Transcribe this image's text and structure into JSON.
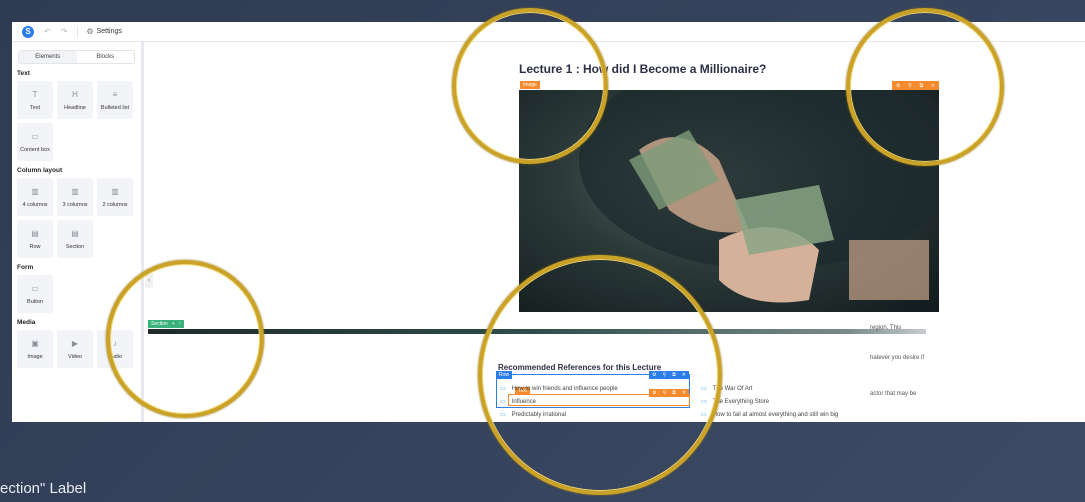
{
  "topbar": {
    "logo_letter": "S",
    "undo": "↶",
    "redo": "↷",
    "settings_label": "Settings"
  },
  "sidebar": {
    "tabs": [
      "Elements",
      "Blocks"
    ],
    "sections": [
      {
        "title": "Text",
        "items": [
          {
            "label": "Text",
            "icon": "T"
          },
          {
            "label": "Headline",
            "icon": "H"
          },
          {
            "label": "Bulleted list",
            "icon": "≡"
          },
          {
            "label": "Content box",
            "icon": "▭"
          }
        ]
      },
      {
        "title": "Column layout",
        "items": [
          {
            "label": "4 columns",
            "icon": "▥"
          },
          {
            "label": "3 columns",
            "icon": "▥"
          },
          {
            "label": "2 columns",
            "icon": "▥"
          },
          {
            "label": "Row",
            "icon": "▤"
          },
          {
            "label": "Section",
            "icon": "▤"
          }
        ]
      },
      {
        "title": "Form",
        "items": [
          {
            "label": "Button",
            "icon": "▭"
          }
        ]
      },
      {
        "title": "Media",
        "items": [
          {
            "label": "Image",
            "icon": "▣"
          },
          {
            "label": "Video",
            "icon": "▶"
          },
          {
            "label": "Audio",
            "icon": "♪"
          }
        ]
      }
    ]
  },
  "canvas": {
    "lecture_title": "Lecture 1 : How did I Become a Millionaire?",
    "image_badge": "Image",
    "section_label": "Section",
    "side_texts": [
      "region. This",
      "hatever you desire if",
      "actor that may be"
    ],
    "refs_title": "Recommended References for this Lecture",
    "row_badge": "Row",
    "text_badge": "Text",
    "refs_left": [
      "How to win friends and influence people",
      "Influence",
      "Predictably irrational"
    ],
    "refs_right": [
      "The War Of Art",
      "The Everything Store",
      "How to fail at almost everything and still win big"
    ]
  },
  "caption": "ection\" Label"
}
